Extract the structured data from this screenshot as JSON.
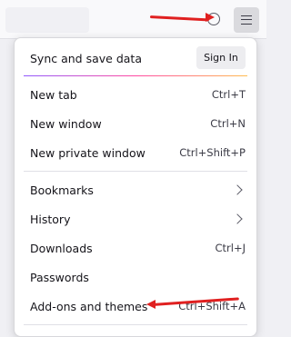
{
  "menu": {
    "sync": {
      "label": "Sync and save data",
      "sign_in": "Sign In"
    },
    "group1": [
      {
        "label": "New tab",
        "shortcut": "Ctrl+T"
      },
      {
        "label": "New window",
        "shortcut": "Ctrl+N"
      },
      {
        "label": "New private window",
        "shortcut": "Ctrl+Shift+P"
      }
    ],
    "group2": [
      {
        "label": "Bookmarks",
        "has_submenu": true
      },
      {
        "label": "History",
        "has_submenu": true
      },
      {
        "label": "Downloads",
        "shortcut": "Ctrl+J"
      },
      {
        "label": "Passwords"
      },
      {
        "label": "Add-ons and themes",
        "shortcut": "Ctrl+Shift+A"
      }
    ]
  },
  "icons": {
    "menu_button": "hamburger-menu-icon",
    "submenu": "chevron-right-icon",
    "extension": "extension-icon"
  },
  "colors": {
    "annotation_arrow": "#e02020",
    "menu_button_active": "#dadade"
  }
}
